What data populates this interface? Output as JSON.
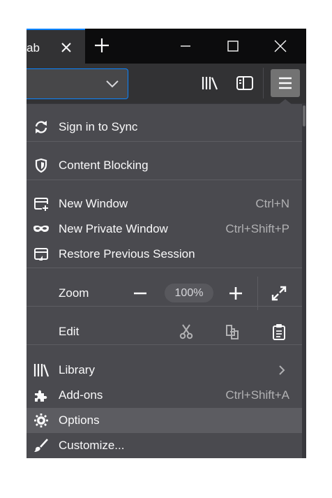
{
  "tab": {
    "title": "ab"
  },
  "menu": {
    "sign_in": "Sign in to Sync",
    "content_blocking": "Content Blocking",
    "new_window": {
      "label": "New Window",
      "shortcut": "Ctrl+N"
    },
    "new_private_window": {
      "label": "New Private Window",
      "shortcut": "Ctrl+Shift+P"
    },
    "restore_session": "Restore Previous Session",
    "zoom": {
      "label": "Zoom",
      "level": "100%"
    },
    "edit": {
      "label": "Edit"
    },
    "library": "Library",
    "addons": {
      "label": "Add-ons",
      "shortcut": "Ctrl+Shift+A"
    },
    "options": "Options",
    "customize": "Customize..."
  },
  "icons": [
    "close-icon",
    "new-tab-icon",
    "minimize-icon",
    "maximize-icon",
    "dropdown-icon",
    "library-icon",
    "sidebar-icon",
    "hamburger-menu-icon",
    "sync-icon",
    "shield-icon",
    "new-window-icon",
    "private-mask-icon",
    "restore-session-icon",
    "zoom-out-icon",
    "zoom-in-icon",
    "fullscreen-icon",
    "cut-icon",
    "copy-icon",
    "paste-icon",
    "chevron-right-icon",
    "puzzle-icon",
    "gear-icon",
    "paintbrush-icon"
  ],
  "colors": {
    "accent": "#0a84ff",
    "panel": "#4a4a4f",
    "highlight": "#5c5c61",
    "toolbar": "#323234",
    "titlebar": "#0c0c0d"
  }
}
